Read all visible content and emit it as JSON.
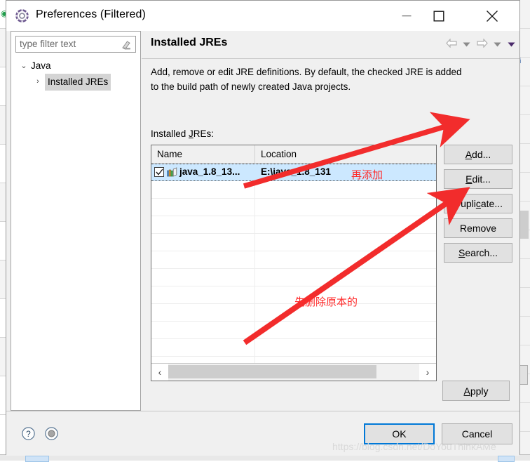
{
  "window": {
    "title": "Preferences (Filtered)",
    "icon": "preferences-gear-icon",
    "controls": {
      "minimize": "minimize-icon",
      "maximize": "maximize-icon",
      "close": "close-icon"
    }
  },
  "sidebar": {
    "filter": {
      "placeholder": "type filter text",
      "value": "",
      "clear_icon": "eraser-icon"
    },
    "tree": [
      {
        "label": "Java",
        "arrow": "⌄",
        "level": 0,
        "expanded": true,
        "selected": false
      },
      {
        "label": "Installed JREs",
        "arrow": "›",
        "level": 1,
        "expanded": false,
        "selected": true
      }
    ]
  },
  "page": {
    "title": "Installed JREs",
    "description": "Add, remove or edit JRE definitions. By default, the checked JRE is added to the build path of newly created Java projects.",
    "list_label": "Installed JREs:",
    "list_label_mnemonic": "J",
    "nav": [
      {
        "name": "back-arrow-icon",
        "type": "arrow-left"
      },
      {
        "name": "back-dropdown-icon",
        "type": "caret"
      },
      {
        "name": "forward-arrow-icon",
        "type": "arrow-right"
      },
      {
        "name": "forward-dropdown-icon",
        "type": "caret"
      },
      {
        "name": "view-menu-icon",
        "type": "caret-purple"
      }
    ]
  },
  "table": {
    "columns": [
      "Name",
      "Location"
    ],
    "rows": [
      {
        "checked": true,
        "icon": "jre-library-icon",
        "name": "java_1.8_13...",
        "location": "E:\\java_1.8_131",
        "selected": true
      },
      {
        "checked": null,
        "name": "",
        "location": "",
        "selected": false
      },
      {
        "checked": null,
        "name": "",
        "location": "",
        "selected": false
      },
      {
        "checked": null,
        "name": "",
        "location": "",
        "selected": false
      },
      {
        "checked": null,
        "name": "",
        "location": "",
        "selected": false
      },
      {
        "checked": null,
        "name": "",
        "location": "",
        "selected": false
      },
      {
        "checked": null,
        "name": "",
        "location": "",
        "selected": false
      },
      {
        "checked": null,
        "name": "",
        "location": "",
        "selected": false
      },
      {
        "checked": null,
        "name": "",
        "location": "",
        "selected": false
      },
      {
        "checked": null,
        "name": "",
        "location": "",
        "selected": false
      },
      {
        "checked": null,
        "name": "",
        "location": "",
        "selected": false
      },
      {
        "checked": null,
        "name": "",
        "location": "",
        "selected": false
      }
    ],
    "scrollbar": {
      "left_arrow": "‹",
      "right_arrow": "›"
    }
  },
  "buttons": {
    "add": {
      "label": "Add...",
      "mnemonic": "A"
    },
    "edit": {
      "label": "Edit...",
      "mnemonic": "E"
    },
    "duplicate": {
      "label": "Duplicate...",
      "mnemonic": "c"
    },
    "remove": {
      "label": "Remove",
      "mnemonic": ""
    },
    "search": {
      "label": "Search...",
      "mnemonic": "S"
    },
    "apply": {
      "label": "Apply",
      "mnemonic": "A"
    },
    "ok": {
      "label": "OK",
      "default": true
    },
    "cancel": {
      "label": "Cancel"
    }
  },
  "footer": {
    "help_icon": "question-mark-icon",
    "secondary_icon": "circle-icon"
  },
  "annotations": [
    {
      "text": "再添加",
      "color": "#ff2b2b",
      "points_to": "add-button"
    },
    {
      "text": "先删除原本的",
      "color": "#ff2b2b",
      "points_to": "remove-button"
    }
  ],
  "watermark": "https://blog.csdn.net/DoYouThinkAMe",
  "colors": {
    "selection_blue": "#cce8ff",
    "default_button_border": "#0078d7",
    "annotation_red": "#ff2b2b",
    "dialog_bg": "#f0f0f0"
  }
}
